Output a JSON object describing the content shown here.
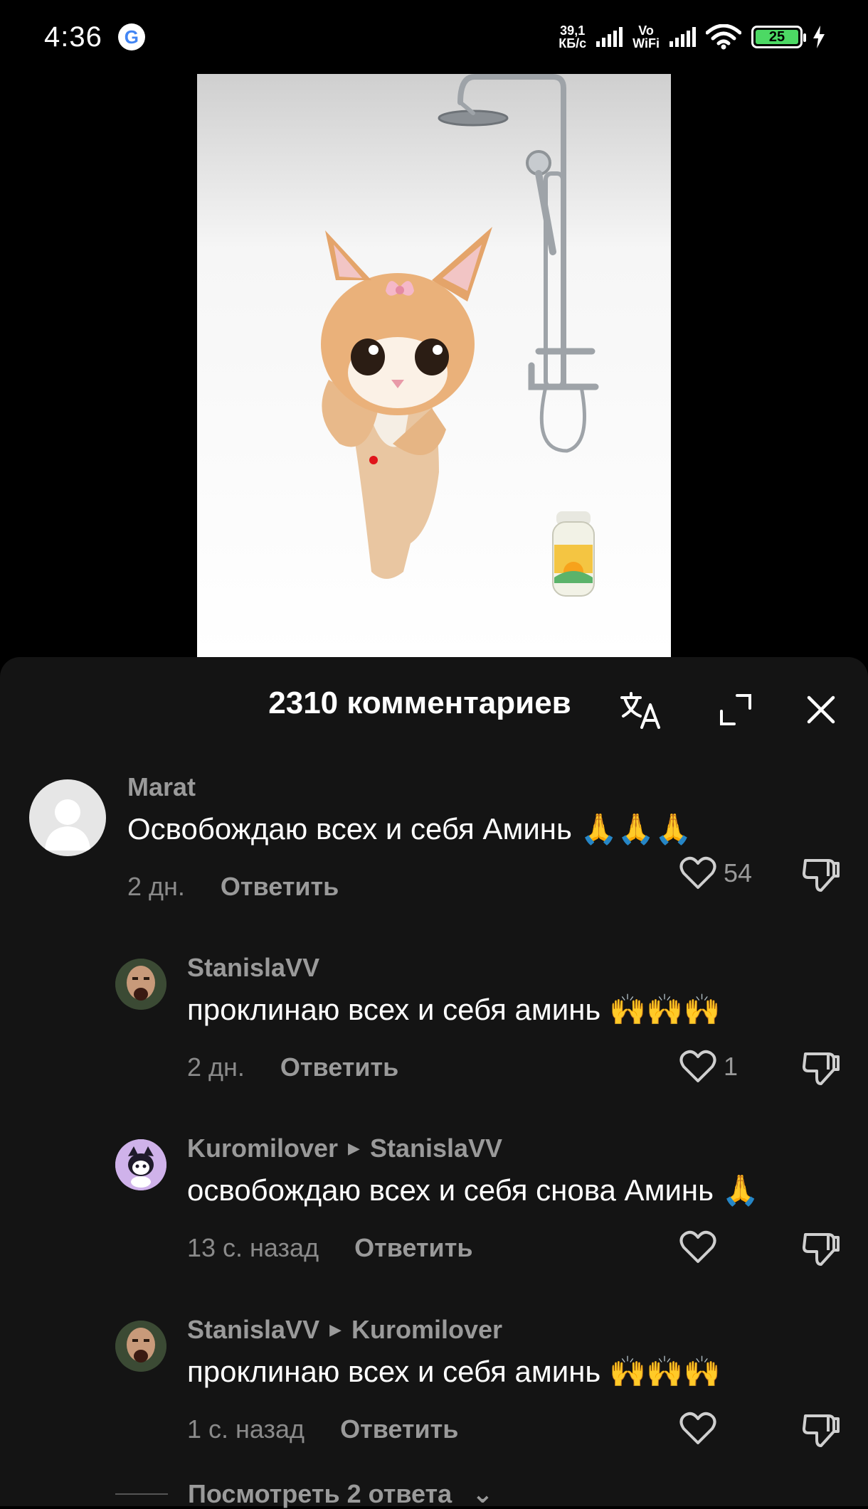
{
  "status_bar": {
    "time": "4:36",
    "google_icon": "G",
    "net_speed_value": "39,1",
    "net_speed_unit": "КБ/с",
    "vowifi_top": "Vo",
    "vowifi_bottom": "WiFi",
    "battery": "25",
    "colors": {
      "battery_fill": "#4CD964"
    }
  },
  "video": {
    "icons": [
      "cat-sticker",
      "shower-fixture",
      "shampoo-bottle"
    ]
  },
  "comments_header": {
    "count_label": "2310 комментариев",
    "icons": [
      "translate-icon",
      "expand-icon",
      "close-icon"
    ]
  },
  "comments": [
    {
      "user": "Marat",
      "reply_to": "",
      "text": "Освобождаю всех и себя Аминь 🙏🙏🙏",
      "time": "2 дн.",
      "reply_label": "Ответить",
      "likes": "54"
    },
    {
      "user": "StanislaVV",
      "reply_to": "",
      "text": "проклинаю всех и себя аминь 🙌🙌🙌",
      "time": "2 дн.",
      "reply_label": "Ответить",
      "likes": "1"
    },
    {
      "user": "Kuromilover",
      "reply_to": "StanislaVV",
      "text": "освобождаю всех и себя снова Аминь 🙏",
      "time": "13 с. назад",
      "reply_label": "Ответить",
      "likes": ""
    },
    {
      "user": "StanislaVV",
      "reply_to": "Kuromilover",
      "text": "проклинаю всех и себя аминь 🙌🙌🙌",
      "time": "1 с. назад",
      "reply_label": "Ответить",
      "likes": ""
    }
  ],
  "view_replies": "Посмотреть 2 ответа"
}
